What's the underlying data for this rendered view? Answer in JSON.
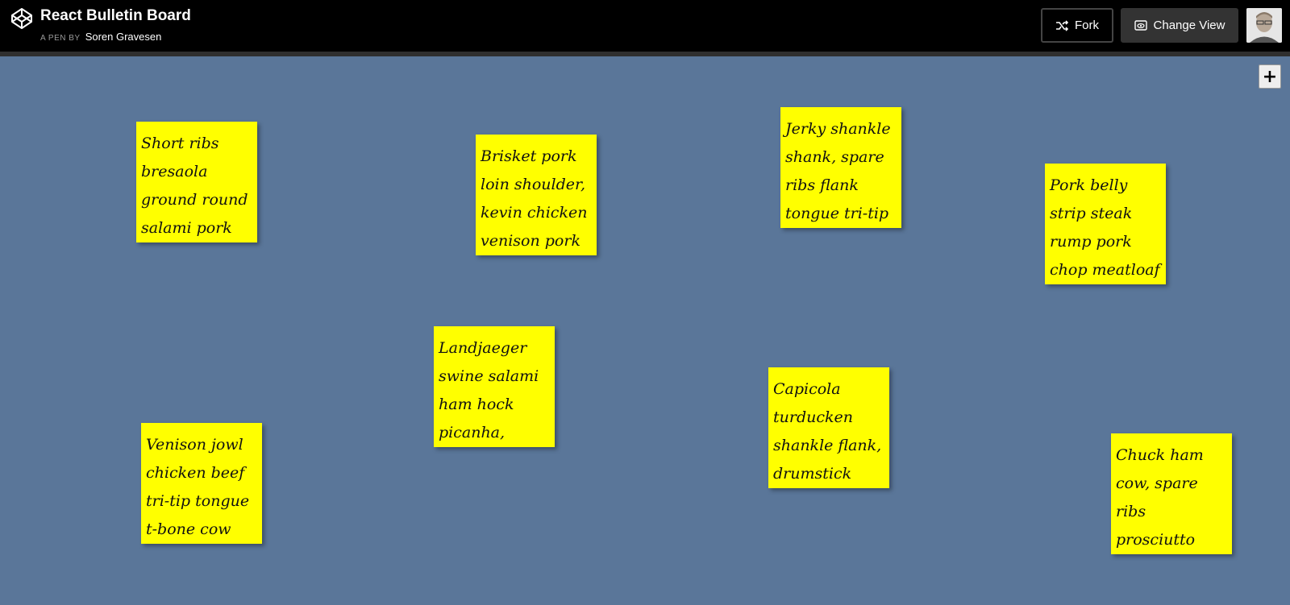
{
  "header": {
    "title": "React Bulletin Board",
    "byline_prefix": "A PEN BY",
    "author": "Soren Gravesen",
    "fork_label": "Fork",
    "change_view_label": "Change View",
    "add_label": "+"
  },
  "notes": [
    "Short ribs bresaola ground round salami pork loin hamburger",
    "Brisket pork loin shoulder, kevin chicken venison pork belly",
    "Jerky shankle shank, spare ribs flank tongue tri-tip corned",
    "Pork belly strip steak rump pork chop meatloaf sausage filet",
    "Landjaeger swine salami ham hock picanha, short loin bacon",
    "Capicola turducken shankle flank, drumstick pork",
    "Venison jowl chicken beef tri-tip tongue t-bone cow",
    "Chuck ham cow, spare ribs prosciutto beef ribeye shank."
  ],
  "colors": {
    "board": "#5a7699",
    "note": "#ffff00",
    "topbar": "#000000"
  }
}
